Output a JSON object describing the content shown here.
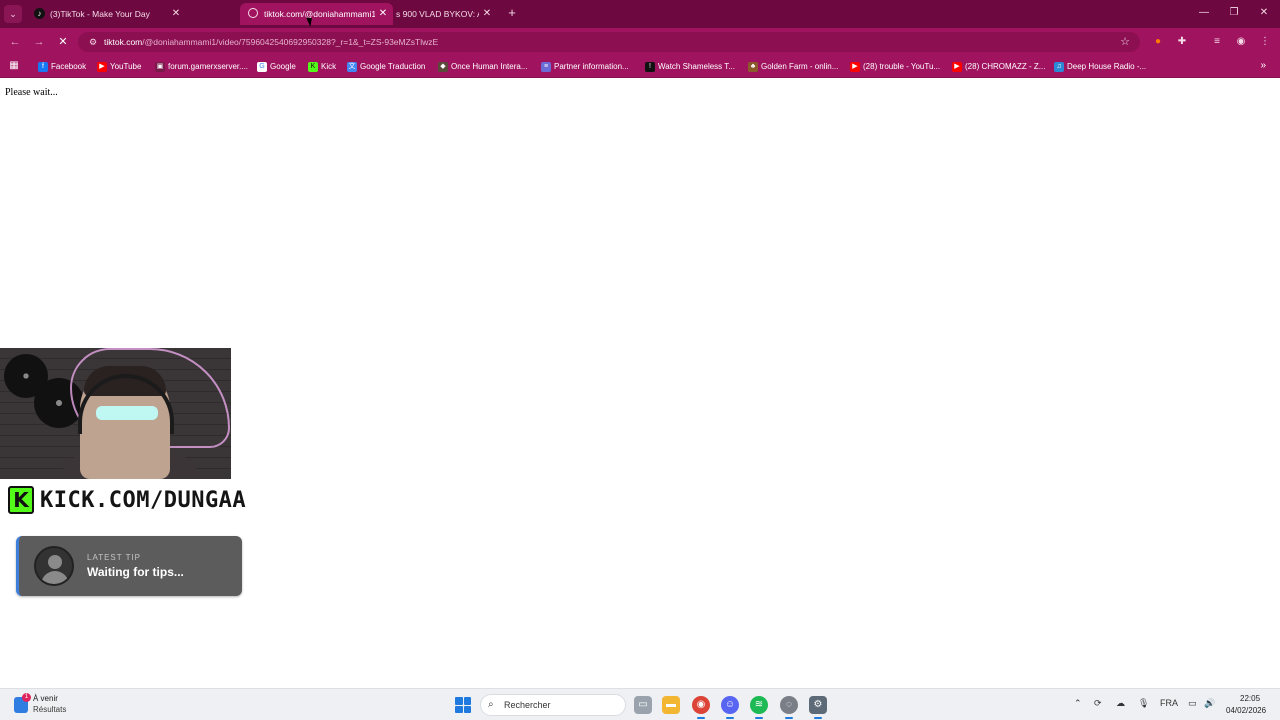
{
  "browser": {
    "tabs": [
      {
        "label": "(3)TikTok - Make Your Day",
        "icon": "tiktok-icon",
        "active": false
      },
      {
        "label": "tiktok.com/@doniahammami1/",
        "icon": "loading-icon",
        "active": true
      },
      {
        "label": "s 900 VLAD BYKOV: A",
        "icon": "",
        "active": false
      }
    ],
    "tab_close": "✕",
    "new_tab": "+",
    "address": {
      "host": "tiktok.com",
      "path": "/@doniahammami1/video/7596042540692950328?_r=1&_t=ZS-93eMZsTlwzE"
    },
    "bookmarks": [
      {
        "label": "Facebook",
        "icon": "facebook-icon",
        "color": "#1877f2"
      },
      {
        "label": "YouTube",
        "icon": "youtube-icon",
        "color": "#ff0000"
      },
      {
        "label": "forum.gamerxserver....",
        "icon": "forum-icon",
        "color": "#7a1a4a"
      },
      {
        "label": "Google",
        "icon": "google-icon",
        "color": "#ffffff"
      },
      {
        "label": "Kick",
        "icon": "kick-icon",
        "color": "#53fc18"
      },
      {
        "label": "Google Traduction",
        "icon": "translate-icon",
        "color": "#4285f4"
      },
      {
        "label": "Once Human Intera...",
        "icon": "once-human-icon",
        "color": "#5a4a3a"
      },
      {
        "label": "Partner information...",
        "icon": "list-icon",
        "color": "#6b6bd6"
      },
      {
        "label": "Watch Shameless T...",
        "icon": "shameless-icon",
        "color": "#111111"
      },
      {
        "label": "Golden Farm - onlin...",
        "icon": "golden-farm-icon",
        "color": "#8a5a2a"
      },
      {
        "label": "(28) trouble - YouTu...",
        "icon": "youtube-icon",
        "color": "#ff0000"
      },
      {
        "label": "(28) CHROMAZZ - Z...",
        "icon": "youtube-icon",
        "color": "#ff0000"
      },
      {
        "label": "Deep House Radio -...",
        "icon": "radio-icon",
        "color": "#2a8ad6"
      }
    ]
  },
  "page": {
    "status_text": "Please wait..."
  },
  "overlay": {
    "kick_text": "KICK.COM/DUNGAA",
    "tip_label": "LATEST TIP",
    "tip_text": "Waiting for tips..."
  },
  "taskbar": {
    "widgets_title": "À venir",
    "widgets_subtitle": "Résultats",
    "widgets_badge": "1",
    "search_placeholder": "Rechercher",
    "language": "FRA",
    "time": "22:05",
    "date": "04/02/2026"
  },
  "colors": {
    "tab_strip": "#6e0840",
    "toolbar": "#a0135f",
    "kick_green": "#53fc18"
  }
}
